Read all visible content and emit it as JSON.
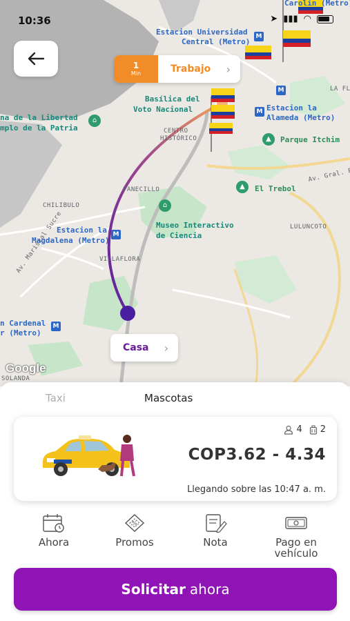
{
  "status_bar": {
    "time": "10:36"
  },
  "map": {
    "labels": {
      "estacion_universidad": "Estacion Universidad",
      "central_metro": "Central (Metro)",
      "basilica_1": "Basílica del",
      "basilica_2": "Voto Nacional",
      "libertad_1": "na de la Libertad",
      "libertad_2": "mplo de la Patria",
      "centro_historico_1": "CENTRO",
      "centro_historico_2": "HISTÓRICO",
      "estacion_alameda_1": "Estacion la",
      "estacion_alameda_2": "Alameda (Metro)",
      "parque_itchimbia": "Parque Itchim",
      "la_fl": "LA FL",
      "panecillo": "PANECILLO",
      "el_trebol": "El Trebol",
      "av_gral": "Av. Gral. Rum",
      "chilibulo": "CHILIBULO",
      "museo_1": "Museo Interactivo",
      "museo_2": "de Ciencia",
      "luluncoto": "LULUNCOTO",
      "magdalena_1": "Estacion la",
      "magdalena_2": "Magdalena (Metro)",
      "villaflora": "VILLAFLORA",
      "av_mariscal": "Av. Mariscal Sucre",
      "cardenal_1": "n Cardenal",
      "cardenal_2": "r (Metro)",
      "solanda": "SOLANDA",
      "carolina": "Carolin (Metro)",
      "metro_badge": "M"
    },
    "destination_chip": {
      "eta_value": "1",
      "eta_unit": "Min",
      "name": "Trabajo"
    },
    "origin_chip": {
      "name": "Casa"
    },
    "google_logo": "Google",
    "route_colors": {
      "start": "#5b1fa0",
      "end": "#f5a25a"
    }
  },
  "sheet": {
    "tabs": [
      {
        "label": "Taxi"
      },
      {
        "label": "Mascotas"
      }
    ],
    "vehicle": {
      "passengers": "4",
      "luggage": "2",
      "price": "COP3.62 - 4.34",
      "arrival": "Llegando sobre las 10:47 a. m."
    },
    "options": [
      {
        "label": "Ahora",
        "icon": "calendar-clock-icon"
      },
      {
        "label": "Promos",
        "icon": "ticket-icon"
      },
      {
        "label": "Nota",
        "icon": "note-pencil-icon"
      },
      {
        "label_line1": "Pago en",
        "label_line2": "vehículo",
        "icon": "cash-icon"
      }
    ],
    "cta": {
      "label_strong": "Solicitar",
      "label_rest": "ahora"
    }
  },
  "colors": {
    "accent": "#9014b5",
    "orange": "#f28c28",
    "purple_text": "#6a1b9a"
  }
}
